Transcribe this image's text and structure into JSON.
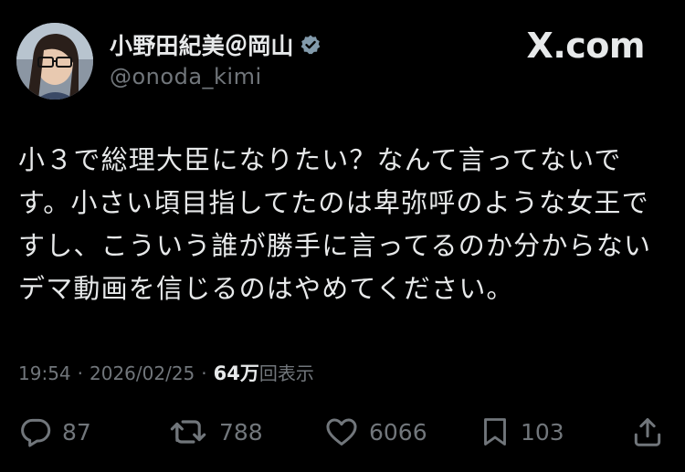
{
  "header": {
    "display_name": "小野田紀美＠岡山",
    "handle": "@onoda_kimi",
    "brand": "X.com",
    "verified_color": "#829aab"
  },
  "tweet": {
    "lines": [
      "小３で総理大臣になりたい？なんて言ってないで",
      "す。小さい頃目指してたのは卑弥呼のような女王で",
      "すし、こういう誰が勝手に言ってるのか分からない",
      "デマ動画を信じるのはやめてください。"
    ]
  },
  "meta": {
    "time": "19:54",
    "date": "2026/02/25",
    "separator": "·",
    "views_count": "64万",
    "views_label": "回表示"
  },
  "actions": {
    "reply": {
      "icon": "reply-icon",
      "count": "87"
    },
    "retweet": {
      "icon": "retweet-icon",
      "count": "788"
    },
    "like": {
      "icon": "heart-icon",
      "count": "6066"
    },
    "bookmark": {
      "icon": "bookmark-icon",
      "count": "103"
    },
    "share": {
      "icon": "share-icon"
    }
  },
  "colors": {
    "background": "#000000",
    "text": "#e7e9ea",
    "secondary": "#71767b"
  }
}
